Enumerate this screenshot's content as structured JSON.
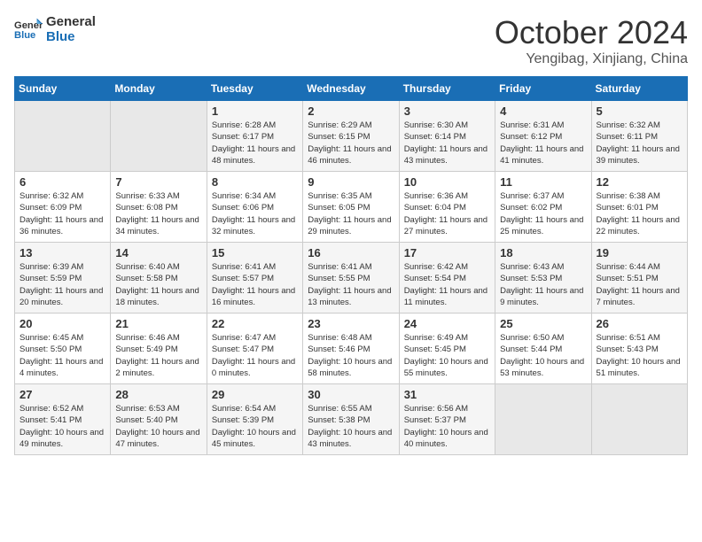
{
  "logo": {
    "line1": "General",
    "line2": "Blue"
  },
  "title": "October 2024",
  "subtitle": "Yengibag, Xinjiang, China",
  "header_days": [
    "Sunday",
    "Monday",
    "Tuesday",
    "Wednesday",
    "Thursday",
    "Friday",
    "Saturday"
  ],
  "weeks": [
    [
      {
        "day": "",
        "sunrise": "",
        "sunset": "",
        "daylight": "",
        "empty": true
      },
      {
        "day": "",
        "sunrise": "",
        "sunset": "",
        "daylight": "",
        "empty": true
      },
      {
        "day": "1",
        "sunrise": "Sunrise: 6:28 AM",
        "sunset": "Sunset: 6:17 PM",
        "daylight": "Daylight: 11 hours and 48 minutes."
      },
      {
        "day": "2",
        "sunrise": "Sunrise: 6:29 AM",
        "sunset": "Sunset: 6:15 PM",
        "daylight": "Daylight: 11 hours and 46 minutes."
      },
      {
        "day": "3",
        "sunrise": "Sunrise: 6:30 AM",
        "sunset": "Sunset: 6:14 PM",
        "daylight": "Daylight: 11 hours and 43 minutes."
      },
      {
        "day": "4",
        "sunrise": "Sunrise: 6:31 AM",
        "sunset": "Sunset: 6:12 PM",
        "daylight": "Daylight: 11 hours and 41 minutes."
      },
      {
        "day": "5",
        "sunrise": "Sunrise: 6:32 AM",
        "sunset": "Sunset: 6:11 PM",
        "daylight": "Daylight: 11 hours and 39 minutes."
      }
    ],
    [
      {
        "day": "6",
        "sunrise": "Sunrise: 6:32 AM",
        "sunset": "Sunset: 6:09 PM",
        "daylight": "Daylight: 11 hours and 36 minutes."
      },
      {
        "day": "7",
        "sunrise": "Sunrise: 6:33 AM",
        "sunset": "Sunset: 6:08 PM",
        "daylight": "Daylight: 11 hours and 34 minutes."
      },
      {
        "day": "8",
        "sunrise": "Sunrise: 6:34 AM",
        "sunset": "Sunset: 6:06 PM",
        "daylight": "Daylight: 11 hours and 32 minutes."
      },
      {
        "day": "9",
        "sunrise": "Sunrise: 6:35 AM",
        "sunset": "Sunset: 6:05 PM",
        "daylight": "Daylight: 11 hours and 29 minutes."
      },
      {
        "day": "10",
        "sunrise": "Sunrise: 6:36 AM",
        "sunset": "Sunset: 6:04 PM",
        "daylight": "Daylight: 11 hours and 27 minutes."
      },
      {
        "day": "11",
        "sunrise": "Sunrise: 6:37 AM",
        "sunset": "Sunset: 6:02 PM",
        "daylight": "Daylight: 11 hours and 25 minutes."
      },
      {
        "day": "12",
        "sunrise": "Sunrise: 6:38 AM",
        "sunset": "Sunset: 6:01 PM",
        "daylight": "Daylight: 11 hours and 22 minutes."
      }
    ],
    [
      {
        "day": "13",
        "sunrise": "Sunrise: 6:39 AM",
        "sunset": "Sunset: 5:59 PM",
        "daylight": "Daylight: 11 hours and 20 minutes."
      },
      {
        "day": "14",
        "sunrise": "Sunrise: 6:40 AM",
        "sunset": "Sunset: 5:58 PM",
        "daylight": "Daylight: 11 hours and 18 minutes."
      },
      {
        "day": "15",
        "sunrise": "Sunrise: 6:41 AM",
        "sunset": "Sunset: 5:57 PM",
        "daylight": "Daylight: 11 hours and 16 minutes."
      },
      {
        "day": "16",
        "sunrise": "Sunrise: 6:41 AM",
        "sunset": "Sunset: 5:55 PM",
        "daylight": "Daylight: 11 hours and 13 minutes."
      },
      {
        "day": "17",
        "sunrise": "Sunrise: 6:42 AM",
        "sunset": "Sunset: 5:54 PM",
        "daylight": "Daylight: 11 hours and 11 minutes."
      },
      {
        "day": "18",
        "sunrise": "Sunrise: 6:43 AM",
        "sunset": "Sunset: 5:53 PM",
        "daylight": "Daylight: 11 hours and 9 minutes."
      },
      {
        "day": "19",
        "sunrise": "Sunrise: 6:44 AM",
        "sunset": "Sunset: 5:51 PM",
        "daylight": "Daylight: 11 hours and 7 minutes."
      }
    ],
    [
      {
        "day": "20",
        "sunrise": "Sunrise: 6:45 AM",
        "sunset": "Sunset: 5:50 PM",
        "daylight": "Daylight: 11 hours and 4 minutes."
      },
      {
        "day": "21",
        "sunrise": "Sunrise: 6:46 AM",
        "sunset": "Sunset: 5:49 PM",
        "daylight": "Daylight: 11 hours and 2 minutes."
      },
      {
        "day": "22",
        "sunrise": "Sunrise: 6:47 AM",
        "sunset": "Sunset: 5:47 PM",
        "daylight": "Daylight: 11 hours and 0 minutes."
      },
      {
        "day": "23",
        "sunrise": "Sunrise: 6:48 AM",
        "sunset": "Sunset: 5:46 PM",
        "daylight": "Daylight: 10 hours and 58 minutes."
      },
      {
        "day": "24",
        "sunrise": "Sunrise: 6:49 AM",
        "sunset": "Sunset: 5:45 PM",
        "daylight": "Daylight: 10 hours and 55 minutes."
      },
      {
        "day": "25",
        "sunrise": "Sunrise: 6:50 AM",
        "sunset": "Sunset: 5:44 PM",
        "daylight": "Daylight: 10 hours and 53 minutes."
      },
      {
        "day": "26",
        "sunrise": "Sunrise: 6:51 AM",
        "sunset": "Sunset: 5:43 PM",
        "daylight": "Daylight: 10 hours and 51 minutes."
      }
    ],
    [
      {
        "day": "27",
        "sunrise": "Sunrise: 6:52 AM",
        "sunset": "Sunset: 5:41 PM",
        "daylight": "Daylight: 10 hours and 49 minutes."
      },
      {
        "day": "28",
        "sunrise": "Sunrise: 6:53 AM",
        "sunset": "Sunset: 5:40 PM",
        "daylight": "Daylight: 10 hours and 47 minutes."
      },
      {
        "day": "29",
        "sunrise": "Sunrise: 6:54 AM",
        "sunset": "Sunset: 5:39 PM",
        "daylight": "Daylight: 10 hours and 45 minutes."
      },
      {
        "day": "30",
        "sunrise": "Sunrise: 6:55 AM",
        "sunset": "Sunset: 5:38 PM",
        "daylight": "Daylight: 10 hours and 43 minutes."
      },
      {
        "day": "31",
        "sunrise": "Sunrise: 6:56 AM",
        "sunset": "Sunset: 5:37 PM",
        "daylight": "Daylight: 10 hours and 40 minutes."
      },
      {
        "day": "",
        "sunrise": "",
        "sunset": "",
        "daylight": "",
        "empty": true
      },
      {
        "day": "",
        "sunrise": "",
        "sunset": "",
        "daylight": "",
        "empty": true
      }
    ]
  ]
}
